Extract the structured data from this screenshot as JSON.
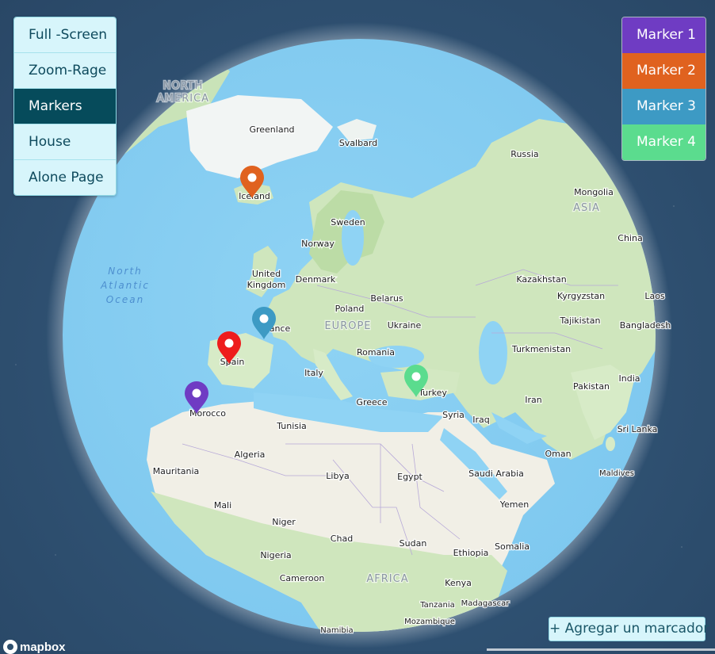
{
  "nav": {
    "items": [
      {
        "label": "Full -Screen",
        "active": false
      },
      {
        "label": "Zoom-Rage",
        "active": false
      },
      {
        "label": "Markers",
        "active": true
      },
      {
        "label": "House",
        "active": false
      },
      {
        "label": "Alone Page",
        "active": false
      }
    ]
  },
  "markers": {
    "buttons": [
      {
        "label": "Marker 1",
        "color": "#6f3cc3"
      },
      {
        "label": "Marker 2",
        "color": "#e0621f"
      },
      {
        "label": "Marker 3",
        "color": "#3d9ac4"
      },
      {
        "label": "Marker 4",
        "color": "#5bdc8e"
      }
    ]
  },
  "add_marker_button": "+ Agregar un marcador",
  "logo": "mapbox",
  "map": {
    "labels": {
      "north_america": [
        "NORTH",
        "AMERICA"
      ],
      "greenland": "Greenland",
      "svalbard": "Svalbard",
      "russia": "Russia",
      "iceland": "Iceland",
      "mongolia": "Mongolia",
      "asia": "ASIA",
      "sweden": "Sweden",
      "norway": "Norway",
      "china": "China",
      "north_atlantic_ocean": [
        "North",
        "Atlantic",
        "Ocean"
      ],
      "united_kingdom": [
        "United",
        "Kingdom"
      ],
      "denmark": "Denmark",
      "kazakhstan": "Kazakhstan",
      "belarus": "Belarus",
      "poland": "Poland",
      "kyrgyzstan": "Kyrgyzstan",
      "laos": "Laos",
      "france": "France",
      "europe": "EUROPE",
      "ukraine": "Ukraine",
      "tajikistan": "Tajikistan",
      "bangladesh": "Bangladesh",
      "turkmenistan": "Turkmenistan",
      "romania": "Romania",
      "spain": "Spain",
      "italy": "Italy",
      "india": "India",
      "turkey": "Turkey",
      "pakistan": "Pakistan",
      "morocco": "Morocco",
      "greece": "Greece",
      "iran": "Iran",
      "syria": "Syria",
      "iraq": "Iraq",
      "tunisia": "Tunisia",
      "sri_lanka": "Sri Lanka",
      "algeria": "Algeria",
      "oman": "Oman",
      "mauritania": "Mauritania",
      "libya": "Libya",
      "egypt": "Egypt",
      "saudi_arabia": "Saudi Arabia",
      "maldives": "Maldives",
      "mali": "Mali",
      "yemen": "Yemen",
      "niger": "Niger",
      "chad": "Chad",
      "sudan": "Sudan",
      "somalia": "Somalia",
      "nigeria": "Nigeria",
      "ethiopia": "Ethiopia",
      "cameroon": "Cameroon",
      "africa": "AFRICA",
      "kenya": "Kenya",
      "tanzania": "Tanzania",
      "madagascar": "Madagascar",
      "namibia": "Namibia",
      "mozambique": "Mozambique"
    },
    "pins": [
      {
        "name": "iceland",
        "color": "#e0621f"
      },
      {
        "name": "france",
        "color": "#3d9ac4"
      },
      {
        "name": "spain",
        "color": "#ee1c1c"
      },
      {
        "name": "morocco",
        "color": "#6f3cc3"
      },
      {
        "name": "turkey",
        "color": "#5bdc8e"
      }
    ]
  }
}
